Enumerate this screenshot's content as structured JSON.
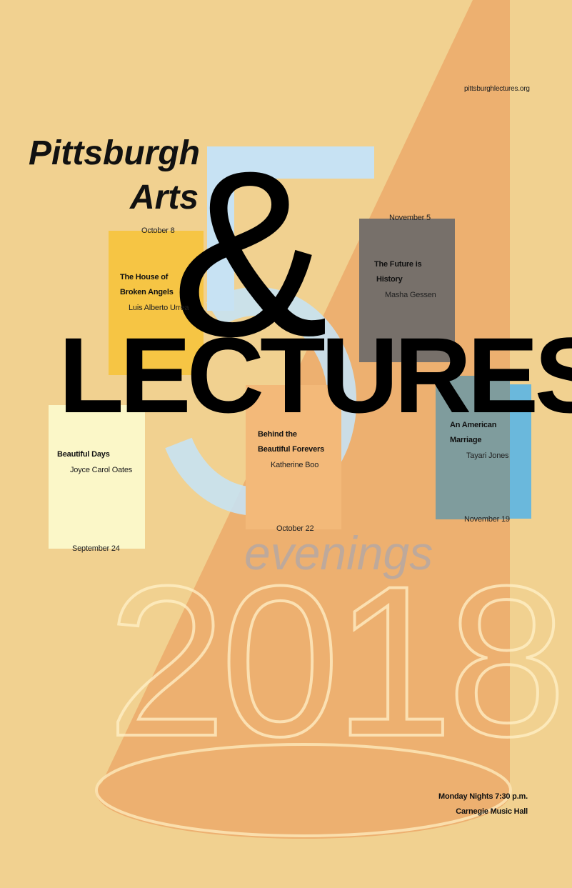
{
  "website": "pittsburghlectures.org",
  "title": {
    "line1": "Pittsburgh",
    "line2": "Arts",
    "ampersand": "&",
    "main": "LECTURES"
  },
  "big_number": "5",
  "subtitle": "evenings",
  "year": "2018",
  "events": [
    {
      "date": "September 24",
      "title_lines": [
        "Beautiful Days"
      ],
      "speaker": "Joyce Carol Oates",
      "color": "#fbf7c8"
    },
    {
      "date": "October 8",
      "title_lines": [
        "The House of",
        "Broken Angels"
      ],
      "speaker": "Luis Alberto Urrea",
      "color": "#f6c544"
    },
    {
      "date": "October 22",
      "title_lines": [
        "Behind the",
        "Beautiful Forevers"
      ],
      "speaker": "Katherine Boo",
      "color": "#f3b979"
    },
    {
      "date": "November 5",
      "title_lines": [
        "The Future is",
        "History"
      ],
      "speaker": "Masha Gessen",
      "color": "#77706a"
    },
    {
      "date": "November 19",
      "title_lines": [
        "An American",
        "Marriage"
      ],
      "speaker": "Tayari Jones",
      "color": "#7f9c9d"
    }
  ],
  "footer": {
    "schedule": "Monday Nights 7:30 p.m.",
    "venue": "Carnegie Music Hall"
  },
  "colors": {
    "background": "#f1d190",
    "spotlight": "#edb070",
    "five": "#c7e2f3",
    "accent_blue": "#6ab8dc"
  }
}
